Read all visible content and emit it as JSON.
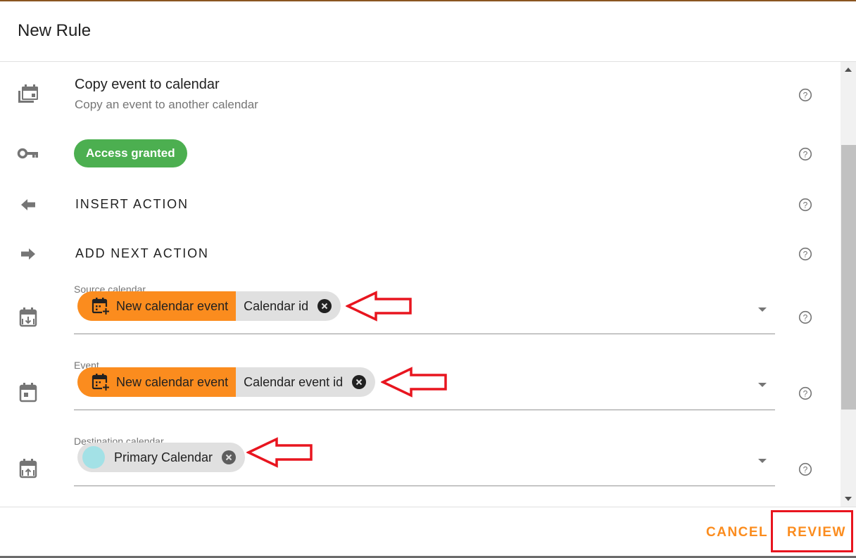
{
  "dialog": {
    "title": "New Rule"
  },
  "action": {
    "title": "Copy event to calendar",
    "subtitle": "Copy an event to another calendar",
    "icon": "calendar-copy-icon"
  },
  "access": {
    "label": "Access granted",
    "color": "#4caf50",
    "icon": "key-icon"
  },
  "insert_action": {
    "label": "INSERT ACTION",
    "icon": "arrow-left-icon"
  },
  "add_next_action": {
    "label": "ADD NEXT ACTION",
    "icon": "arrow-right-icon"
  },
  "fields": [
    {
      "label": "Source calendar",
      "icon": "calendar-download-icon",
      "chip_source": "New calendar event",
      "chip_value": "Calendar id"
    },
    {
      "label": "Event",
      "icon": "calendar-event-icon",
      "chip_source": "New calendar event",
      "chip_value": "Calendar event id"
    },
    {
      "label": "Destination calendar",
      "icon": "calendar-upload-icon",
      "chip_value": "Primary Calendar",
      "chip_color": "#a3e1e6"
    }
  ],
  "footer": {
    "cancel_label": "CANCEL",
    "review_label": "REVIEW"
  },
  "colors": {
    "accent": "#fb8c1e",
    "annotation": "#e8151f"
  }
}
